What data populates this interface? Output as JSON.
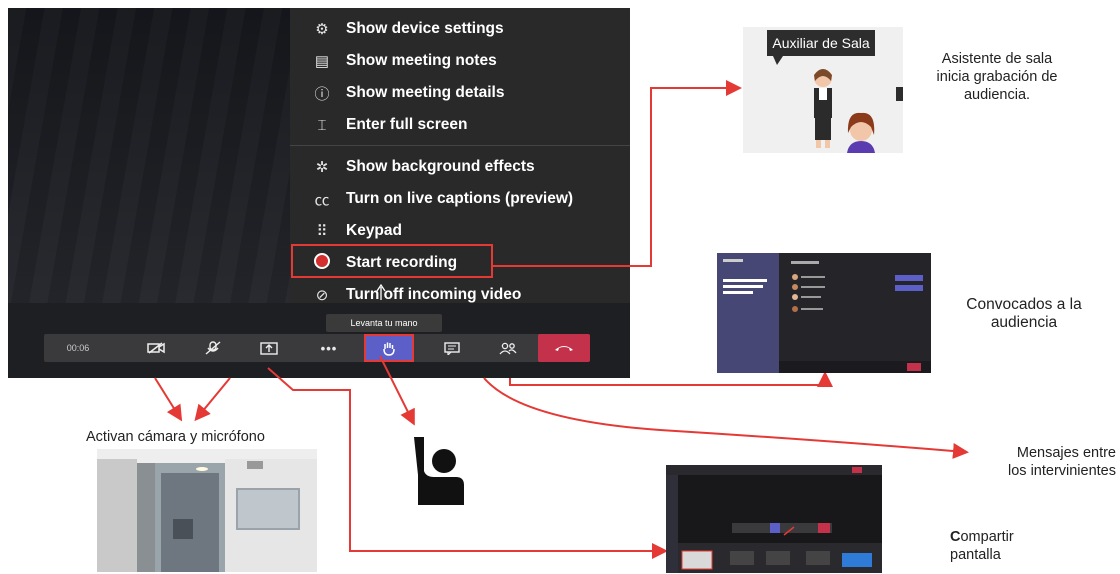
{
  "menu": {
    "items": [
      {
        "icon": "gear-icon",
        "glyph": "⚙",
        "label": "Show device settings"
      },
      {
        "icon": "notes-icon",
        "glyph": "▤",
        "label": "Show meeting notes"
      },
      {
        "icon": "info-icon",
        "glyph": "ⓘ",
        "label": "Show meeting details"
      },
      {
        "icon": "fullscreen-icon",
        "glyph": "⌶",
        "label": "Enter full screen"
      },
      {
        "icon": "background-effects-icon",
        "glyph": "✲",
        "label": "Show background effects"
      },
      {
        "icon": "captions-icon",
        "glyph": "㏄",
        "label": "Turn on live captions (preview)"
      },
      {
        "icon": "keypad-icon",
        "glyph": "⠿",
        "label": "Keypad"
      },
      {
        "icon": "record-icon",
        "glyph": "",
        "label": "Start recording"
      },
      {
        "icon": "video-off-icon",
        "glyph": "⊘",
        "label": "Turn off incoming video"
      }
    ]
  },
  "tooltip": "Levanta tu mano",
  "toolbar": {
    "timer": "00:06",
    "buttons": [
      "camera-off-icon",
      "mic-off-icon",
      "share-screen-icon",
      "more-icon",
      "raise-hand-icon",
      "chat-icon",
      "participants-icon",
      "hang-up-icon"
    ]
  },
  "assistant_image": {
    "label": "Auxiliar de Sala"
  },
  "captions": {
    "assistant": "Asistente de sala\ninicia grabación de\naudiencia.",
    "attendees": "Convocados a la\naudiencia",
    "messages": "Mensajes entre\nlos intervinientes",
    "share_prefix": "C",
    "share_rest": "ompartir\npantalla",
    "camera_mic": "Activan cámara y micrófono"
  },
  "colors": {
    "arrow": "#e53935",
    "menu_bg": "#292929",
    "accent": "#5b5fc7",
    "hangup": "#c4314b"
  }
}
